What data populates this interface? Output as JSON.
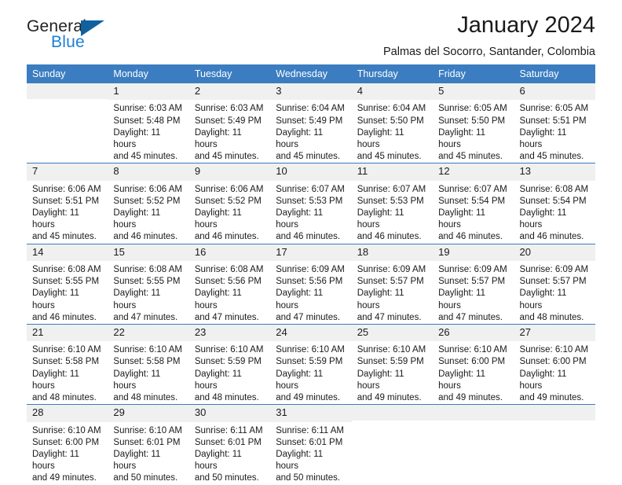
{
  "brand": {
    "name_top": "General",
    "name_bottom": "Blue",
    "triangle_color": "#11619f",
    "blue_color": "#1c7fd4"
  },
  "header": {
    "title": "January 2024",
    "subtitle": "Palmas del Socorro, Santander, Colombia"
  },
  "theme": {
    "header_bg": "#3b7dc0",
    "daynum_bg": "#f0f0f0",
    "text": "#1a1a1a"
  },
  "weekday_headers": [
    "Sunday",
    "Monday",
    "Tuesday",
    "Wednesday",
    "Thursday",
    "Friday",
    "Saturday"
  ],
  "weeks": [
    [
      {
        "day": "",
        "sunrise": "",
        "sunset": "",
        "daylight1": "",
        "daylight2": "",
        "blank": true
      },
      {
        "day": "1",
        "sunrise": "Sunrise: 6:03 AM",
        "sunset": "Sunset: 5:48 PM",
        "daylight1": "Daylight: 11 hours",
        "daylight2": "and 45 minutes."
      },
      {
        "day": "2",
        "sunrise": "Sunrise: 6:03 AM",
        "sunset": "Sunset: 5:49 PM",
        "daylight1": "Daylight: 11 hours",
        "daylight2": "and 45 minutes."
      },
      {
        "day": "3",
        "sunrise": "Sunrise: 6:04 AM",
        "sunset": "Sunset: 5:49 PM",
        "daylight1": "Daylight: 11 hours",
        "daylight2": "and 45 minutes."
      },
      {
        "day": "4",
        "sunrise": "Sunrise: 6:04 AM",
        "sunset": "Sunset: 5:50 PM",
        "daylight1": "Daylight: 11 hours",
        "daylight2": "and 45 minutes."
      },
      {
        "day": "5",
        "sunrise": "Sunrise: 6:05 AM",
        "sunset": "Sunset: 5:50 PM",
        "daylight1": "Daylight: 11 hours",
        "daylight2": "and 45 minutes."
      },
      {
        "day": "6",
        "sunrise": "Sunrise: 6:05 AM",
        "sunset": "Sunset: 5:51 PM",
        "daylight1": "Daylight: 11 hours",
        "daylight2": "and 45 minutes."
      }
    ],
    [
      {
        "day": "7",
        "sunrise": "Sunrise: 6:06 AM",
        "sunset": "Sunset: 5:51 PM",
        "daylight1": "Daylight: 11 hours",
        "daylight2": "and 45 minutes."
      },
      {
        "day": "8",
        "sunrise": "Sunrise: 6:06 AM",
        "sunset": "Sunset: 5:52 PM",
        "daylight1": "Daylight: 11 hours",
        "daylight2": "and 46 minutes."
      },
      {
        "day": "9",
        "sunrise": "Sunrise: 6:06 AM",
        "sunset": "Sunset: 5:52 PM",
        "daylight1": "Daylight: 11 hours",
        "daylight2": "and 46 minutes."
      },
      {
        "day": "10",
        "sunrise": "Sunrise: 6:07 AM",
        "sunset": "Sunset: 5:53 PM",
        "daylight1": "Daylight: 11 hours",
        "daylight2": "and 46 minutes."
      },
      {
        "day": "11",
        "sunrise": "Sunrise: 6:07 AM",
        "sunset": "Sunset: 5:53 PM",
        "daylight1": "Daylight: 11 hours",
        "daylight2": "and 46 minutes."
      },
      {
        "day": "12",
        "sunrise": "Sunrise: 6:07 AM",
        "sunset": "Sunset: 5:54 PM",
        "daylight1": "Daylight: 11 hours",
        "daylight2": "and 46 minutes."
      },
      {
        "day": "13",
        "sunrise": "Sunrise: 6:08 AM",
        "sunset": "Sunset: 5:54 PM",
        "daylight1": "Daylight: 11 hours",
        "daylight2": "and 46 minutes."
      }
    ],
    [
      {
        "day": "14",
        "sunrise": "Sunrise: 6:08 AM",
        "sunset": "Sunset: 5:55 PM",
        "daylight1": "Daylight: 11 hours",
        "daylight2": "and 46 minutes."
      },
      {
        "day": "15",
        "sunrise": "Sunrise: 6:08 AM",
        "sunset": "Sunset: 5:55 PM",
        "daylight1": "Daylight: 11 hours",
        "daylight2": "and 47 minutes."
      },
      {
        "day": "16",
        "sunrise": "Sunrise: 6:08 AM",
        "sunset": "Sunset: 5:56 PM",
        "daylight1": "Daylight: 11 hours",
        "daylight2": "and 47 minutes."
      },
      {
        "day": "17",
        "sunrise": "Sunrise: 6:09 AM",
        "sunset": "Sunset: 5:56 PM",
        "daylight1": "Daylight: 11 hours",
        "daylight2": "and 47 minutes."
      },
      {
        "day": "18",
        "sunrise": "Sunrise: 6:09 AM",
        "sunset": "Sunset: 5:57 PM",
        "daylight1": "Daylight: 11 hours",
        "daylight2": "and 47 minutes."
      },
      {
        "day": "19",
        "sunrise": "Sunrise: 6:09 AM",
        "sunset": "Sunset: 5:57 PM",
        "daylight1": "Daylight: 11 hours",
        "daylight2": "and 47 minutes."
      },
      {
        "day": "20",
        "sunrise": "Sunrise: 6:09 AM",
        "sunset": "Sunset: 5:57 PM",
        "daylight1": "Daylight: 11 hours",
        "daylight2": "and 48 minutes."
      }
    ],
    [
      {
        "day": "21",
        "sunrise": "Sunrise: 6:10 AM",
        "sunset": "Sunset: 5:58 PM",
        "daylight1": "Daylight: 11 hours",
        "daylight2": "and 48 minutes."
      },
      {
        "day": "22",
        "sunrise": "Sunrise: 6:10 AM",
        "sunset": "Sunset: 5:58 PM",
        "daylight1": "Daylight: 11 hours",
        "daylight2": "and 48 minutes."
      },
      {
        "day": "23",
        "sunrise": "Sunrise: 6:10 AM",
        "sunset": "Sunset: 5:59 PM",
        "daylight1": "Daylight: 11 hours",
        "daylight2": "and 48 minutes."
      },
      {
        "day": "24",
        "sunrise": "Sunrise: 6:10 AM",
        "sunset": "Sunset: 5:59 PM",
        "daylight1": "Daylight: 11 hours",
        "daylight2": "and 49 minutes."
      },
      {
        "day": "25",
        "sunrise": "Sunrise: 6:10 AM",
        "sunset": "Sunset: 5:59 PM",
        "daylight1": "Daylight: 11 hours",
        "daylight2": "and 49 minutes."
      },
      {
        "day": "26",
        "sunrise": "Sunrise: 6:10 AM",
        "sunset": "Sunset: 6:00 PM",
        "daylight1": "Daylight: 11 hours",
        "daylight2": "and 49 minutes."
      },
      {
        "day": "27",
        "sunrise": "Sunrise: 6:10 AM",
        "sunset": "Sunset: 6:00 PM",
        "daylight1": "Daylight: 11 hours",
        "daylight2": "and 49 minutes."
      }
    ],
    [
      {
        "day": "28",
        "sunrise": "Sunrise: 6:10 AM",
        "sunset": "Sunset: 6:00 PM",
        "daylight1": "Daylight: 11 hours",
        "daylight2": "and 49 minutes."
      },
      {
        "day": "29",
        "sunrise": "Sunrise: 6:10 AM",
        "sunset": "Sunset: 6:01 PM",
        "daylight1": "Daylight: 11 hours",
        "daylight2": "and 50 minutes."
      },
      {
        "day": "30",
        "sunrise": "Sunrise: 6:11 AM",
        "sunset": "Sunset: 6:01 PM",
        "daylight1": "Daylight: 11 hours",
        "daylight2": "and 50 minutes."
      },
      {
        "day": "31",
        "sunrise": "Sunrise: 6:11 AM",
        "sunset": "Sunset: 6:01 PM",
        "daylight1": "Daylight: 11 hours",
        "daylight2": "and 50 minutes."
      },
      {
        "day": "",
        "sunrise": "",
        "sunset": "",
        "daylight1": "",
        "daylight2": "",
        "blank": true
      },
      {
        "day": "",
        "sunrise": "",
        "sunset": "",
        "daylight1": "",
        "daylight2": "",
        "blank": true
      },
      {
        "day": "",
        "sunrise": "",
        "sunset": "",
        "daylight1": "",
        "daylight2": "",
        "blank": true
      }
    ]
  ]
}
